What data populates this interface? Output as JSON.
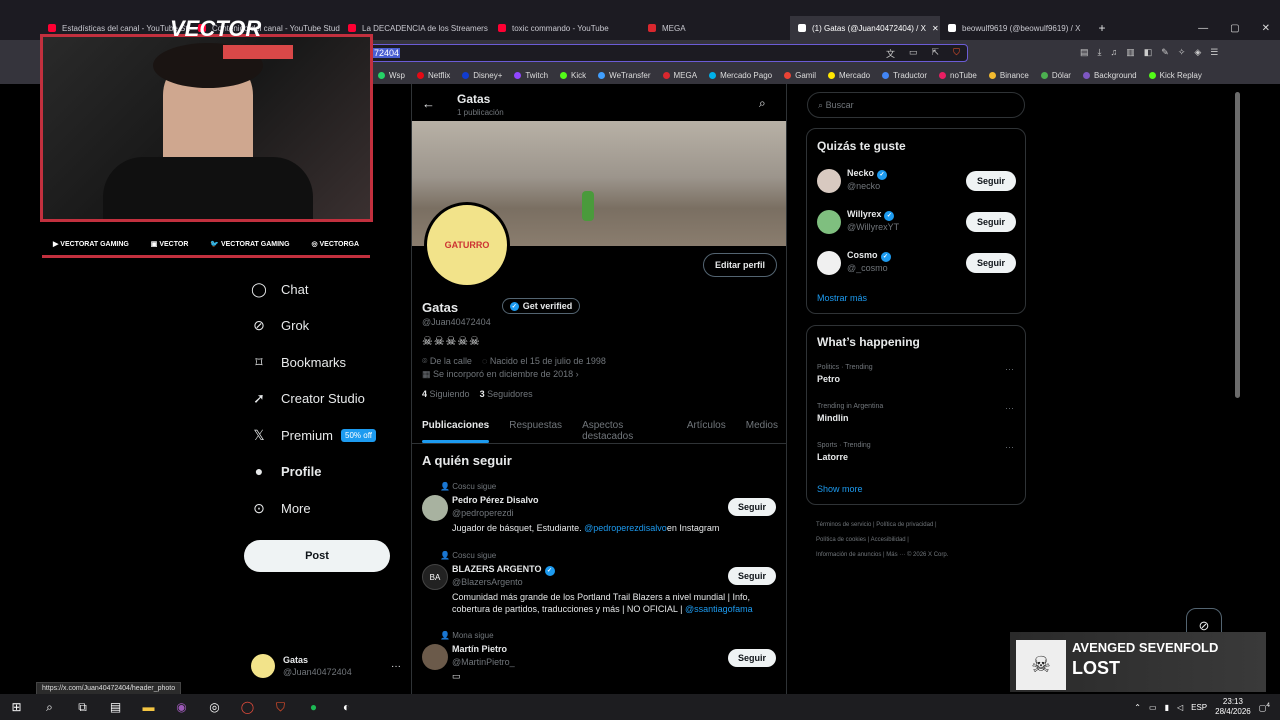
{
  "browser": {
    "tabs": [
      {
        "title": "Estadísticas del canal - YouTube Studio",
        "color": "#ff0033"
      },
      {
        "title": "Contenido del canal - YouTube Studio",
        "color": "#ff0033"
      },
      {
        "title": "La DECADENCIA de los Streamers",
        "color": "#ff0033"
      },
      {
        "title": "toxic commando - YouTube",
        "color": "#ff0033"
      },
      {
        "title": "MEGA",
        "color": "#d9272e"
      },
      {
        "title": "(1) Gatas (@Juan40472404) / X",
        "color": "#ffffff",
        "active": true
      },
      {
        "title": "beowulf9619 (@beowulf9619) / X",
        "color": "#ffffff"
      }
    ],
    "url_fragment": "72404",
    "bookmarks": [
      {
        "label": "Wsp",
        "color": "#25d366"
      },
      {
        "label": "Netflix",
        "color": "#e50914"
      },
      {
        "label": "Disney+",
        "color": "#113ccf"
      },
      {
        "label": "Twitch",
        "color": "#9146ff"
      },
      {
        "label": "Kick",
        "color": "#53fc18"
      },
      {
        "label": "WeTransfer",
        "color": "#409fff"
      },
      {
        "label": "MEGA",
        "color": "#d9272e"
      },
      {
        "label": "Mercado Pago",
        "color": "#00b1ea"
      },
      {
        "label": "Gamil",
        "color": "#ea4335"
      },
      {
        "label": "Mercado",
        "color": "#ffe600"
      },
      {
        "label": "Traductor",
        "color": "#4285f4"
      },
      {
        "label": "noTube",
        "color": "#e91e63"
      },
      {
        "label": "Binance",
        "color": "#f3ba2f"
      },
      {
        "label": "Dólar",
        "color": "#4caf50"
      },
      {
        "label": "Background",
        "color": "#7e57c2"
      },
      {
        "label": "Kick Replay",
        "color": "#53fc18"
      }
    ],
    "status_url": "https://x.com/Juan40472404/header_photo"
  },
  "overlay": {
    "logo": "VECTOR",
    "socials": [
      "VECTORAT GAMING",
      "VECTOR",
      "VECTORAT GAMING",
      "VECTORGA"
    ]
  },
  "sidebar": {
    "items": [
      {
        "label": "Chat",
        "icon": "chat-icon"
      },
      {
        "label": "Grok",
        "icon": "grok-icon"
      },
      {
        "label": "Bookmarks",
        "icon": "bookmark-icon"
      },
      {
        "label": "Creator Studio",
        "icon": "rocket-icon"
      },
      {
        "label": "Premium",
        "icon": "x-logo-icon"
      },
      {
        "label": "Profile",
        "icon": "person-icon"
      },
      {
        "label": "More",
        "icon": "more-circle-icon"
      }
    ],
    "premium_badge": "50% off",
    "post_label": "Post",
    "account": {
      "name": "Gatas",
      "handle": "@Juan40472404"
    }
  },
  "profile": {
    "header_name": "Gatas",
    "header_posts": "1 publicación",
    "name": "Gatas",
    "get_verified": "Get verified",
    "handle": "@Juan40472404",
    "bio": "☠☠☠☠☠",
    "location": "De la calle",
    "birth": "Nacido el 15 de julio de 1998",
    "joined": "Se incorporó en diciembre de 2018",
    "following_count": "4",
    "following_label": "Siguiendo",
    "followers_count": "3",
    "followers_label": "Seguidores",
    "edit_label": "Editar perfil",
    "avatar_text": "GATURRO",
    "tabs": [
      "Publicaciones",
      "Respuestas",
      "Aspectos destacados",
      "Artículos",
      "Medios"
    ]
  },
  "who_to_follow": {
    "title": "A quién seguir",
    "follow_label": "Seguir",
    "items": [
      {
        "context": "Coscu sigue",
        "name": "Pedro Pérez Disalvo",
        "handle": "@pedroperezdi",
        "bio": "Jugador de básquet, Estudiante.",
        "bio_link": "@pedroperezdisalvo",
        "bio_tail": "en Instagram",
        "verified": false
      },
      {
        "context": "Coscu sigue",
        "name": "BLAZERS ARGENTO",
        "handle": "@BlazersArgento",
        "bio": "Comunidad más grande de los Portland Trail Blazers a nivel mundial | Info, cobertura de partidos, traducciones y más | NO OFICIAL |",
        "bio_link": "@ssantiagofama",
        "bio_tail": "",
        "verified": true
      },
      {
        "context": "Mona sigue",
        "name": "Martín Pietro",
        "handle": "@MartinPietro_",
        "bio": "",
        "bio_link": "",
        "bio_tail": "",
        "verified": false
      }
    ]
  },
  "right": {
    "search_placeholder": "Buscar",
    "suggest_title": "Quizás te guste",
    "follow_label": "Seguir",
    "suggestions": [
      {
        "name": "Necko",
        "handle": "@necko"
      },
      {
        "name": "Willyrex",
        "handle": "@WillyrexYT"
      },
      {
        "name": "Cosmo",
        "handle": "@_cosmo"
      }
    ],
    "show_more": "Mostrar más",
    "happening_title": "What’s happening",
    "trends": [
      {
        "context": "Politics · Trending",
        "topic": "Petro"
      },
      {
        "context": "Trending in Argentina",
        "topic": "Mindlin"
      },
      {
        "context": "Sports · Trending",
        "topic": "Latorre"
      }
    ],
    "show_more_en": "Show more",
    "footer": [
      "Términos de servicio",
      "Política de privacidad",
      "Política de cookies",
      "Accesibilidad",
      "Información de anuncios",
      "Más ···",
      "© 2026 X Corp."
    ]
  },
  "music": {
    "artist": "AVENGED SEVENFOLD",
    "track": "LOST"
  },
  "taskbar": {
    "lang": "ESP",
    "time": "23:13",
    "date": "28/4/2026",
    "notifications": "4"
  }
}
